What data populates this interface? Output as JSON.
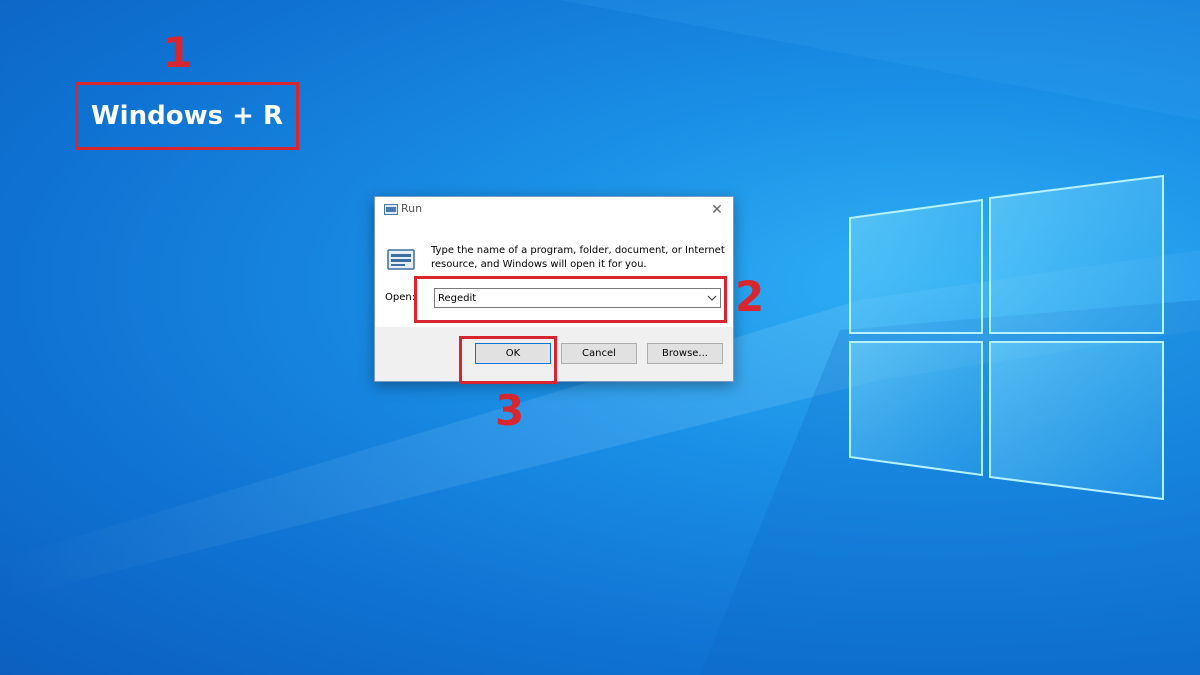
{
  "annotations": {
    "step1": "1",
    "step2": "2",
    "step3": "3",
    "shortcut": "Windows + R"
  },
  "dialog": {
    "title": "Run",
    "description": "Type the name of a program, folder, document, or Internet resource, and Windows will open it for you.",
    "open_label": "Open:",
    "open_value": "Regedit",
    "ok_label": "OK",
    "cancel_label": "Cancel",
    "browse_label": "Browse...",
    "close_glyph": "✕"
  },
  "colors": {
    "annotation": "#d9262e",
    "desktop": "#1a8fe6"
  },
  "icons": {
    "title": "run-icon",
    "body": "run-icon",
    "close": "close-icon",
    "dropdown": "chevron-down-icon"
  }
}
